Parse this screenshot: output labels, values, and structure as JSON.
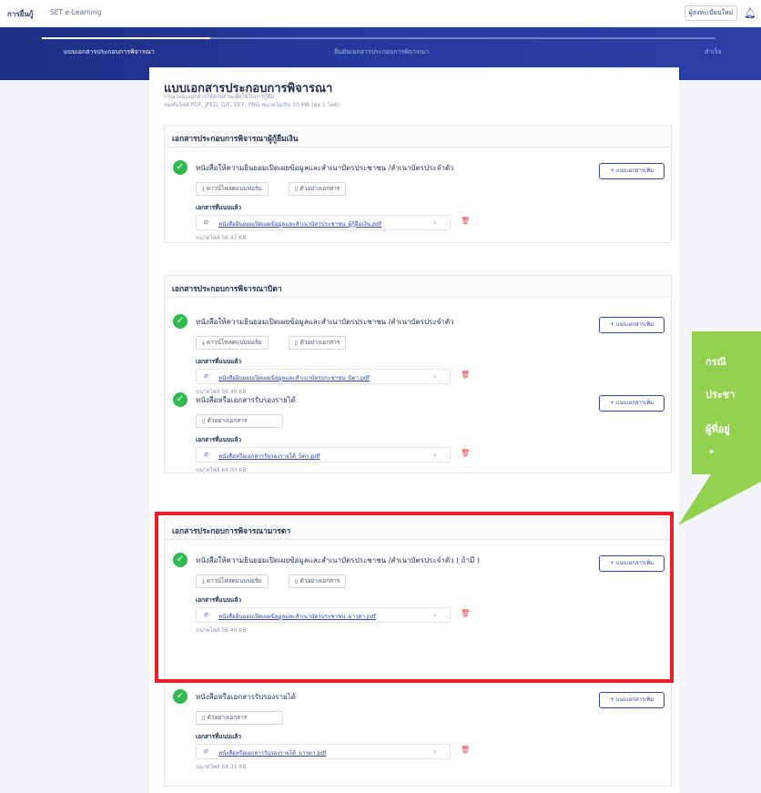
{
  "topbar": {
    "brand": "การยื่นกู้",
    "subtitle": "SET e-Learning",
    "register_label": "ผู้ลงทะเบียนใหม่",
    "bell_icon": "bell-icon"
  },
  "steps": [
    {
      "label": "แบบเอกสารประกอบการพิจารณา"
    },
    {
      "label": "ยืนยันเอกสารประกอบการพิจารณา"
    },
    {
      "label": "สำเร็จ"
    }
  ],
  "page": {
    "title": "แบบเอกสารประกอบการพิจารณา",
    "hint_line1": "กรุณาแนบเอกสารให้ครบถ้วนเพื่อใช้ในการกู้ยืม",
    "hint_line2": "รองรับไฟล์ PDF, JPEG, GIF, TIFF, PNG ขนาดไม่เกิน 10 MB (ต่อ 1 ไฟล์)"
  },
  "common": {
    "add_btn": "+ แนบเอกสารเพิ่ม",
    "download_form": "ดาวน์โหลดแบบฟอร์ม",
    "sample_doc": "ตัวอย่างเอกสาร",
    "attached_label": "เอกสารที่แนบแล้ว"
  },
  "sections": [
    {
      "title": "เอกสารประกอบการพิจารณาผู้กู้ยืมเงิน",
      "docs": [
        {
          "title": "หนังสือให้ความยินยอมเปิดเผยข้อมูลและสำเนาบัตรประชาชน /สำเนาบัตรประจำตัว",
          "file": "หนังสือยินยอมเปิดเผยข้อมูลและสำเนาบัตรประชาชน_ผู้กู้ยืมเงิน.pdf",
          "size": "ขนาดไฟล์ 56.47 KB"
        }
      ]
    },
    {
      "title": "เอกสารประกอบการพิจารณาบิดา",
      "docs": [
        {
          "title": "หนังสือให้ความยินยอมเปิดเผยข้อมูลและสำเนาบัตรประชาชน /สำเนาบัตรประจำตัว",
          "file": "หนังสือยินยอมเปิดเผยข้อมูลและสำเนาบัตรประชาชน_บิดา.pdf",
          "size": "ขนาดไฟล์ 56.40 KB"
        },
        {
          "title": "หนังสือหรือเอกสารรับรองรายได้",
          "file": "หนังสือหรือเอกสารรับรองรายได้_บิดา.pdf",
          "size": "ขนาดไฟล์ 64.00 KB"
        }
      ]
    },
    {
      "title": "เอกสารประกอบการพิจารณามารดา",
      "docs": [
        {
          "title": "หนังสือให้ความยินยอมเปิดเผยข้อมูลและสำเนาบัตรประชาชน /สำเนาบัตรประจำตัว ( ถ้ามี )",
          "file": "หนังสือยินยอมเปิดเผยข้อมูลและสำเนาบัตรประชาชน_มารดา.pdf",
          "size": "ขนาดไฟล์ 56.40 KB"
        },
        {
          "title": "หนังสือหรือเอกสารรับรองรายได้",
          "file": "หนังสือหรือเอกสารรับรองรายได้_มารดา.pdf",
          "size": "ขนาดไฟล์ 64.31 KB"
        }
      ]
    }
  ],
  "callout": {
    "line1": "กรณี",
    "line2": "ประชา",
    "line3": "ผู้ที่อยู่",
    "line4": "•"
  },
  "colors": {
    "stepper_bg": "#1e2f86",
    "accent": "#2f46b0",
    "check": "#31b94f",
    "highlight": "#ee1c25",
    "callout": "#92d050"
  }
}
